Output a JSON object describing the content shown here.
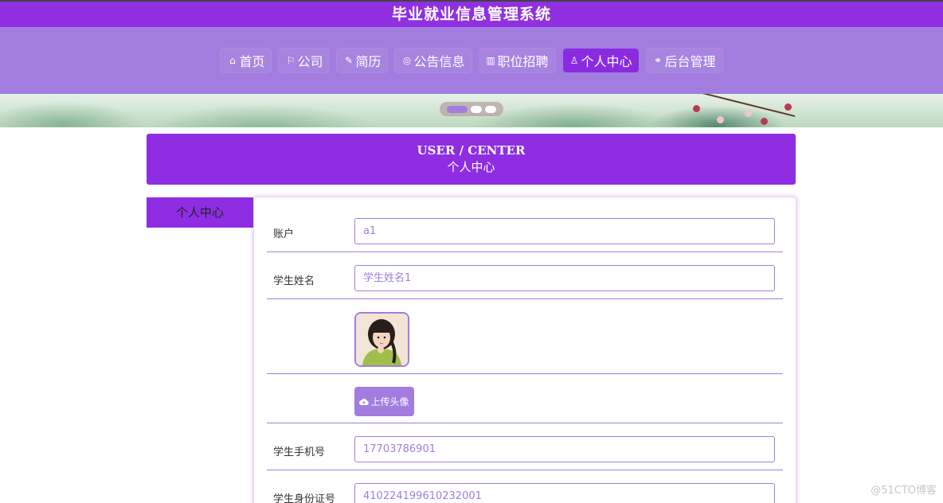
{
  "site": {
    "title": "毕业就业信息管理系统"
  },
  "nav": {
    "items": [
      {
        "icon": "⌂",
        "icon_name": "home-icon",
        "label": "首页"
      },
      {
        "icon": "⚐",
        "icon_name": "flag-icon",
        "label": "公司"
      },
      {
        "icon": "✎",
        "icon_name": "resume-icon",
        "label": "简历"
      },
      {
        "icon": "◎",
        "icon_name": "notice-icon",
        "label": "公告信息"
      },
      {
        "icon": "▥",
        "icon_name": "job-icon",
        "label": "职位招聘"
      },
      {
        "icon": "♙",
        "icon_name": "user-icon",
        "label": "个人中心",
        "active": true
      },
      {
        "icon": "⚭",
        "icon_name": "link-icon",
        "label": "后台管理"
      }
    ]
  },
  "banner": {
    "slides": 3,
    "active_index": 0
  },
  "header": {
    "en": "USER / CENTER",
    "cn": "个人中心"
  },
  "side": {
    "tab": "个人中心"
  },
  "form": {
    "account_label": "账户",
    "account_value": "a1",
    "name_label": "学生姓名",
    "name_value": "学生姓名1",
    "upload_label": "上传头像",
    "phone_label": "学生手机号",
    "phone_value": "17703786901",
    "id_label": "学生身份证号",
    "id_value": "410224199610232001"
  },
  "watermark": "@51CTO博客",
  "colors": {
    "primary": "#8e2de2",
    "nav_bg": "#a27ddf",
    "accent": "#a27ddf"
  }
}
